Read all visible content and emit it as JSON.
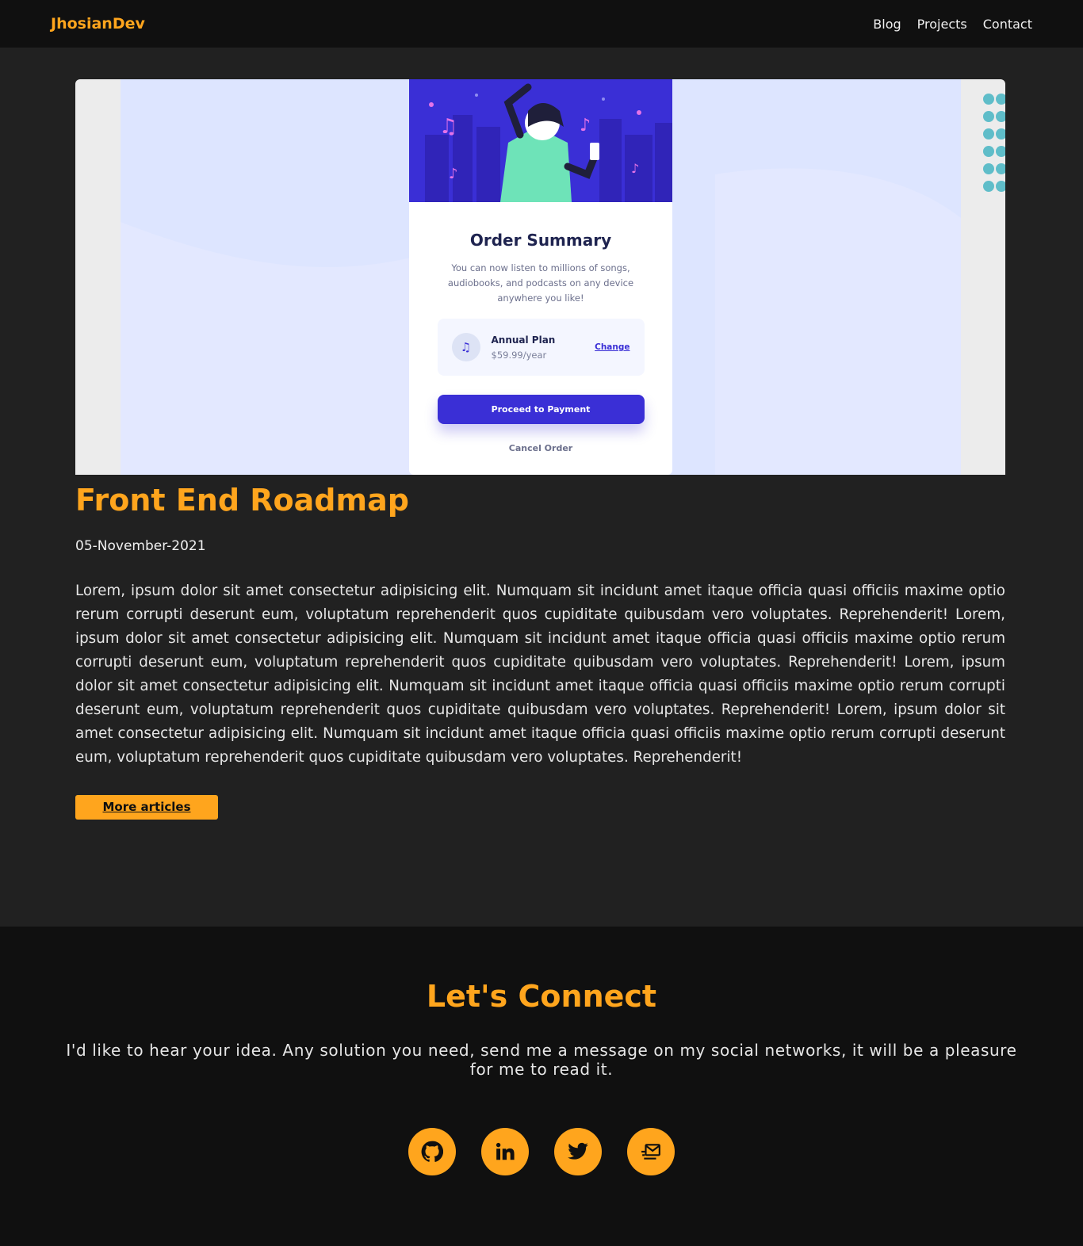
{
  "nav": {
    "brand": "JhosianDev",
    "links": [
      "Blog",
      "Projects",
      "Contact"
    ]
  },
  "hero_card": {
    "title": "Order Summary",
    "description": "You can now listen to millions of songs, audiobooks, and podcasts on any device anywhere you like!",
    "plan_name": "Annual Plan",
    "plan_price": "$59.99/year",
    "change_label": "Change",
    "pay_label": "Proceed to Payment",
    "cancel_label": "Cancel Order"
  },
  "article": {
    "title": "Front End Roadmap",
    "date": "05-November-2021",
    "body": "Lorem, ipsum dolor sit amet consectetur adipisicing elit. Numquam sit incidunt amet itaque officia quasi officiis maxime optio rerum corrupti deserunt eum, voluptatum reprehenderit quos cupiditate quibusdam vero voluptates. Reprehenderit! Lorem, ipsum dolor sit amet consectetur adipisicing elit. Numquam sit incidunt amet itaque officia quasi officiis maxime optio rerum corrupti deserunt eum, voluptatum reprehenderit quos cupiditate quibusdam vero voluptates. Reprehenderit! Lorem, ipsum dolor sit amet consectetur adipisicing elit. Numquam sit incidunt amet itaque officia quasi officiis maxime optio rerum corrupti deserunt eum, voluptatum reprehenderit quos cupiditate quibusdam vero voluptates. Reprehenderit! Lorem, ipsum dolor sit amet consectetur adipisicing elit. Numquam sit incidunt amet itaque officia quasi officiis maxime optio rerum corrupti deserunt eum, voluptatum reprehenderit quos cupiditate quibusdam vero voluptates. Reprehenderit!",
    "more_label": "More articles"
  },
  "connect": {
    "title": "Let's Connect",
    "text": "I'd like to hear your idea. Any solution you need, send me a message on my social networks, it will be a pleasure for me to read it.",
    "socials": [
      "github-icon",
      "linkedin-icon",
      "twitter-icon",
      "mail-icon"
    ]
  },
  "colors": {
    "accent": "#ffa51d",
    "background": "#212121",
    "nav_bg": "#101010",
    "card_purple": "#3a2fd6"
  }
}
